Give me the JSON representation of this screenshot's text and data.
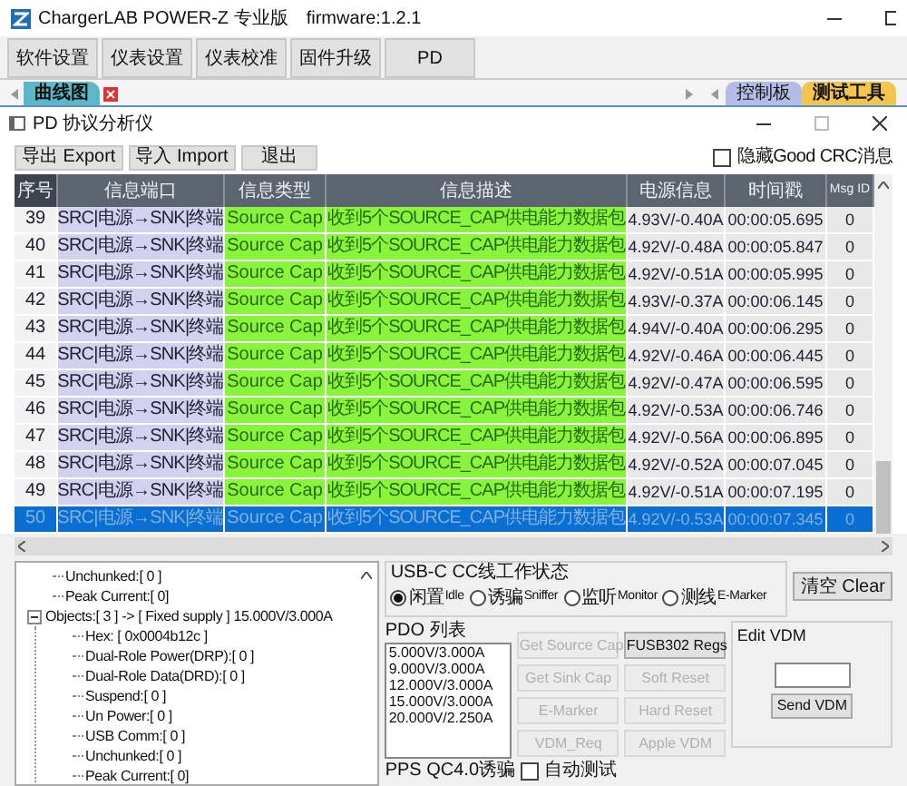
{
  "window": {
    "title": "ChargerLAB POWER-Z 专业版",
    "firmware": "firmware:1.2.1"
  },
  "menu_buttons": [
    "软件设置",
    "仪表设置",
    "仪表校准",
    "固件升级",
    "PD"
  ],
  "tabs_left": [
    {
      "label": "曲线图",
      "selected": true,
      "color": "#5cb8c8"
    }
  ],
  "tabs_right": [
    {
      "label": "控制板",
      "selected": false,
      "color": "#b4bce6"
    },
    {
      "label": "测试工具",
      "selected": true,
      "color": "#f2c64e"
    }
  ],
  "analyzer": {
    "title": "PD 协议分析仪",
    "toolbar": [
      "导出 Export",
      "导入 Import",
      "退出"
    ],
    "hide_good_crc": {
      "label": "隐藏Good CRC消息",
      "checked": false
    }
  },
  "table": {
    "columns": [
      "序号",
      "信息端口",
      "信息类型",
      "信息描述",
      "电源信息",
      "时间戳",
      "Msg ID"
    ],
    "rows": [
      {
        "cells": [
          "39",
          "SRC|电源→SNK|终端",
          "Source Cap",
          "收到5个SOURCE_CAP供电能力数据包",
          "4.93V/-0.40A",
          "00:00:05.695",
          "0"
        ],
        "selected": false
      },
      {
        "cells": [
          "40",
          "SRC|电源→SNK|终端",
          "Source Cap",
          "收到5个SOURCE_CAP供电能力数据包",
          "4.92V/-0.48A",
          "00:00:05.847",
          "0"
        ],
        "selected": false
      },
      {
        "cells": [
          "41",
          "SRC|电源→SNK|终端",
          "Source Cap",
          "收到5个SOURCE_CAP供电能力数据包",
          "4.92V/-0.51A",
          "00:00:05.995",
          "0"
        ],
        "selected": false
      },
      {
        "cells": [
          "42",
          "SRC|电源→SNK|终端",
          "Source Cap",
          "收到5个SOURCE_CAP供电能力数据包",
          "4.93V/-0.37A",
          "00:00:06.145",
          "0"
        ],
        "selected": false
      },
      {
        "cells": [
          "43",
          "SRC|电源→SNK|终端",
          "Source Cap",
          "收到5个SOURCE_CAP供电能力数据包",
          "4.94V/-0.40A",
          "00:00:06.295",
          "0"
        ],
        "selected": false
      },
      {
        "cells": [
          "44",
          "SRC|电源→SNK|终端",
          "Source Cap",
          "收到5个SOURCE_CAP供电能力数据包",
          "4.92V/-0.46A",
          "00:00:06.445",
          "0"
        ],
        "selected": false
      },
      {
        "cells": [
          "45",
          "SRC|电源→SNK|终端",
          "Source Cap",
          "收到5个SOURCE_CAP供电能力数据包",
          "4.92V/-0.47A",
          "00:00:06.595",
          "0"
        ],
        "selected": false
      },
      {
        "cells": [
          "46",
          "SRC|电源→SNK|终端",
          "Source Cap",
          "收到5个SOURCE_CAP供电能力数据包",
          "4.92V/-0.53A",
          "00:00:06.746",
          "0"
        ],
        "selected": false
      },
      {
        "cells": [
          "47",
          "SRC|电源→SNK|终端",
          "Source Cap",
          "收到5个SOURCE_CAP供电能力数据包",
          "4.92V/-0.56A",
          "00:00:06.895",
          "0"
        ],
        "selected": false
      },
      {
        "cells": [
          "48",
          "SRC|电源→SNK|终端",
          "Source Cap",
          "收到5个SOURCE_CAP供电能力数据包",
          "4.92V/-0.52A",
          "00:00:07.045",
          "0"
        ],
        "selected": false
      },
      {
        "cells": [
          "49",
          "SRC|电源→SNK|终端",
          "Source Cap",
          "收到5个SOURCE_CAP供电能力数据包",
          "4.92V/-0.51A",
          "00:00:07.195",
          "0"
        ],
        "selected": false
      },
      {
        "cells": [
          "50",
          "SRC|电源→SNK|终端",
          "Source Cap",
          "收到5个SOURCE_CAP供电能力数据包",
          "4.92V/-0.53A",
          "00:00:07.345",
          "0"
        ],
        "selected": true
      }
    ]
  },
  "tree": [
    {
      "label": "Unchunked:[ 0 ]"
    },
    {
      "label": "Peak Current:[ 0]"
    },
    {
      "label": "Objects:[ 3 ] -> [ Fixed supply ] 15.000V/3.000A",
      "expanded": true,
      "children": [
        {
          "label": "Hex: [ 0x0004b12c ]"
        },
        {
          "label": "Dual-Role Power(DRP):[ 0 ]"
        },
        {
          "label": "Dual-Role Data(DRD):[ 0 ]"
        },
        {
          "label": "Suspend:[ 0 ]"
        },
        {
          "label": "Un Power:[ 0 ]"
        },
        {
          "label": "USB Comm:[ 0 ]"
        },
        {
          "label": "Unchunked:[ 0 ]"
        },
        {
          "label": "Peak Current:[ 0]"
        }
      ]
    }
  ],
  "cc_state": {
    "title": "USB-C CC线工作状态",
    "options": [
      {
        "zh": "闲置",
        "en": "Idle",
        "selected": true
      },
      {
        "zh": "诱骗",
        "en": "Sniffer",
        "selected": false
      },
      {
        "zh": "监听",
        "en": "Monitor",
        "selected": false
      },
      {
        "zh": "测线",
        "en": "E-Marker",
        "selected": false
      }
    ]
  },
  "clear_button": "清空 Clear",
  "pdo": {
    "title": "PDO 列表",
    "items": [
      "5.000V/3.000A",
      "9.000V/3.000A",
      "12.000V/3.000A",
      "15.000V/3.000A",
      "20.000V/2.250A"
    ]
  },
  "actions": [
    {
      "label": "Get Source Cap",
      "disabled": true
    },
    {
      "label": "FUSB302 Regs",
      "disabled": false
    },
    {
      "label": "Get Sink Cap",
      "disabled": true
    },
    {
      "label": "Soft Reset",
      "disabled": true
    },
    {
      "label": "E-Marker",
      "disabled": true
    },
    {
      "label": "Hard Reset",
      "disabled": true
    },
    {
      "label": "VDM_Req",
      "disabled": true
    },
    {
      "label": "Apple VDM",
      "disabled": true
    }
  ],
  "edit_vdm": {
    "title": "Edit VDM",
    "button": "Send VDM"
  },
  "pps": {
    "label": "PPS QC4.0诱骗",
    "auto_test": {
      "label": "自动测试",
      "checked": false
    }
  }
}
